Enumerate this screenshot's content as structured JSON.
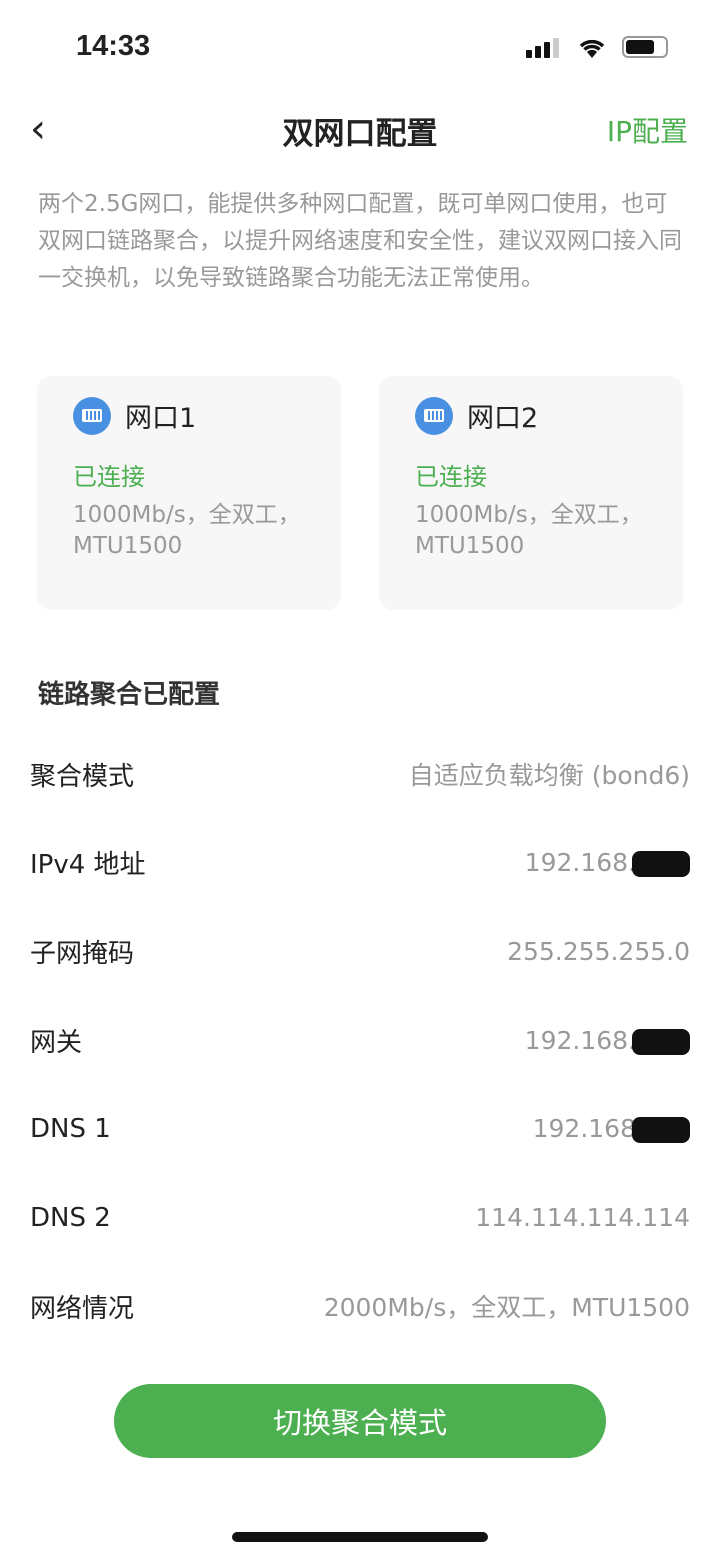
{
  "status_bar": {
    "time": "14:33"
  },
  "nav": {
    "title": "双网口配置",
    "right_action": "IP配置"
  },
  "description": "两个2.5G网口，能提供多种网口配置，既可单网口使用，也可双网口链路聚合，以提升网络速度和安全性，建议双网口接入同一交换机，以免导致链路聚合功能无法正常使用。",
  "ports": [
    {
      "name": "网口1",
      "status": "已连接",
      "info": "1000Mb/s，全双工，MTU1500",
      "icon": "ethernet-port-icon"
    },
    {
      "name": "网口2",
      "status": "已连接",
      "info": "1000Mb/s，全双工，MTU1500",
      "icon": "ethernet-port-icon"
    }
  ],
  "section_title": "链路聚合已配置",
  "rows": [
    {
      "key": "聚合模式",
      "value": "自适应负载均衡 (bond6)",
      "redacted": false
    },
    {
      "key": "IPv4 地址",
      "value": "192.168.",
      "redacted": true
    },
    {
      "key": "子网掩码",
      "value": "255.255.255.0",
      "redacted": false
    },
    {
      "key": "网关",
      "value": "192.168.",
      "redacted": true
    },
    {
      "key": "DNS 1",
      "value": "192.168",
      "redacted": true
    },
    {
      "key": "DNS 2",
      "value": "114.114.114.114",
      "redacted": false
    },
    {
      "key": "网络情况",
      "value": "2000Mb/s，全双工，MTU1500",
      "redacted": false
    }
  ],
  "button": "切换聚合模式",
  "colors": {
    "accent": "#4caf50",
    "port_icon": "#4a90e2"
  }
}
